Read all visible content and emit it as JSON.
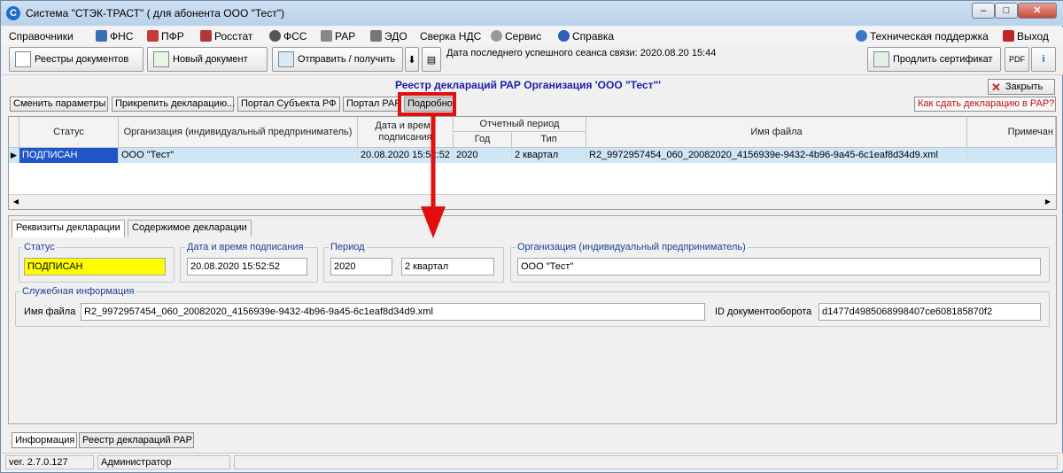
{
  "window": {
    "title": "Система \"СТЭК-ТРАСТ\" ( для абонента ООО \"Тест\")",
    "controls": {
      "minimize": "–",
      "maximize": "□",
      "close": "✕"
    }
  },
  "menu": {
    "items": [
      {
        "label": "Справочники"
      },
      {
        "label": "ФНС"
      },
      {
        "label": "ПФР"
      },
      {
        "label": "Росстат"
      },
      {
        "label": "ФСС"
      },
      {
        "label": "РАР"
      },
      {
        "label": "ЭДО"
      },
      {
        "label": "Сверка НДС"
      },
      {
        "label": "Сервис"
      },
      {
        "label": "Справка"
      }
    ],
    "support": "Техническая поддержка",
    "exit": "Выход"
  },
  "toolbar": {
    "registries": "Реестры документов",
    "new_doc": "Новый документ",
    "send_receive": "Отправить / получить",
    "last_session": "Дата последнего успешного сеанса связи: 2020.08.20 15:44",
    "extend_cert": "Продлить сертификат"
  },
  "registry": {
    "title": "Реестр деклараций РАР  Организация 'ООО \"Тест\"'",
    "close": "Закрыть",
    "buttons": {
      "change_params": "Сменить параметры",
      "attach": "Прикрепить декларацию...",
      "subject_portal": "Портал Субъекта РФ",
      "rar_portal": "Портал РАР",
      "details": "Подробно"
    },
    "how_to": "Как сдать декларацию в РАР?"
  },
  "grid": {
    "headers": {
      "status": "Статус",
      "org": "Организация (индивидуальный предприниматель)",
      "date": "Дата и время подписания",
      "period": "Отчетный период",
      "year": "Год",
      "type": "Тип",
      "file": "Имя файла",
      "note": "Примечан"
    },
    "rows": [
      {
        "status": "ПОДПИСАН",
        "org": "ООО \"Тест\"",
        "date": "20.08.2020 15:52:52",
        "year": "2020",
        "type": "2 квартал",
        "file": "R2_9972957454_060_20082020_4156939e-9432-4b96-9a45-6c1eaf8d34d9.xml"
      }
    ]
  },
  "detail": {
    "tabs": [
      "Реквизиты декларации",
      "Содержимое декларации"
    ],
    "status_label": "Статус",
    "status_value": "ПОДПИСАН",
    "date_label": "Дата и время подписания",
    "date_value": "20.08.2020 15:52:52",
    "period_label": "Период",
    "year_value": "2020",
    "quarter_value": "2 квартал",
    "org_label": "Организация (индивидуальный предприниматель)",
    "org_value": "ООО \"Тест\"",
    "service_label": "Служебная информация",
    "file_label": "Имя файла",
    "file_value": "R2_9972957454_060_20082020_4156939e-9432-4b96-9a45-6c1eaf8d34d9.xml",
    "docflow_label": "ID документооборота",
    "docflow_value": "d1477d4985068998407ce608185870f2"
  },
  "bottom_tabs": [
    "Информация",
    "Реестр деклараций РАР"
  ],
  "status_bar": {
    "version": "ver. 2.7.0.127",
    "user": "Администратор"
  },
  "colors": {
    "highlight": "#e01010",
    "status_field": "#ffff00",
    "title_blue": "#1c1ca8"
  }
}
